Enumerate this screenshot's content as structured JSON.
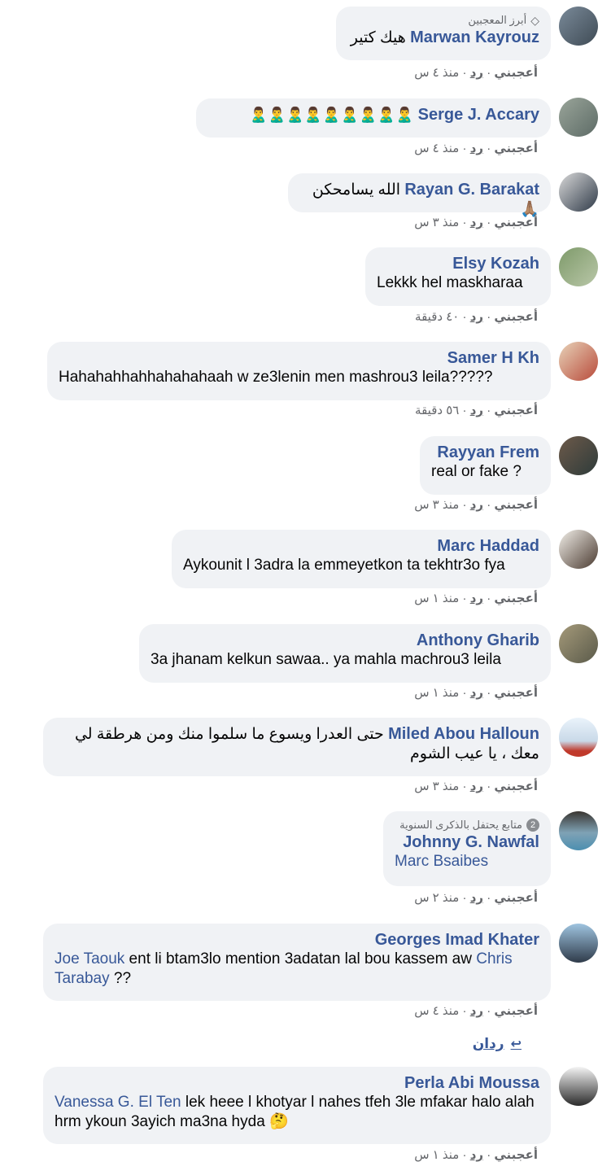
{
  "common": {
    "like": "أعجبني",
    "reply": "رد",
    "dot": "·"
  },
  "comments": [
    {
      "badge": "أبرز المعجبين",
      "name": "Marwan Kayrouz",
      "text": "هيك كتير",
      "time": "منذ ٤ س"
    },
    {
      "name": "Serge J. Accary",
      "text": "🙎‍♂️🙎‍♂️🙎‍♂️🙎‍♂️🙎‍♂️🙎‍♂️🙎‍♂️🙎‍♂️🙎‍♂️",
      "time": "منذ ٤ س"
    },
    {
      "name": "Rayan G. Barakat",
      "text": "الله يسامحكن 🙏🏽",
      "time": "منذ ٣ س"
    },
    {
      "name": "Elsy Kozah",
      "text": "Lekkk hel maskharaa",
      "time": "٤٠ دقيقة"
    },
    {
      "name": "Samer H Kh",
      "text": "Hahahahhahhahahahaah w ze3lenin men mashrou3 leila?????",
      "time": "٥٦ دقيقة"
    },
    {
      "name": "Rayyan Frem",
      "text": "real or fake ?",
      "time": "منذ ٣ س"
    },
    {
      "name": "Marc Haddad",
      "text": "Aykounit l 3adra la emmeyetkon ta tekhtr3o fya",
      "time": "منذ ١ س"
    },
    {
      "name": "Anthony Gharib",
      "text": "3a jhanam kelkun sawaa.. ya mahla machrou3 leila",
      "time": "منذ ١ س"
    },
    {
      "name": "Miled Abou Halloun",
      "text": "حتى العدرا ويسوع ما سلموا منك ومن هرطقة لي معك ، يا عيب الشوم",
      "time": "منذ ٣ س"
    },
    {
      "badge": "متابع يحتفل بالذكرى السنوية",
      "name": "Johnny G. Nawfal",
      "mention": "Marc Bsaibes",
      "time": "منذ ٢ س"
    },
    {
      "name": "Georges Imad Khater",
      "mention1": "Joe Taouk",
      "text1": " ent li btam3lo mention 3adatan lal bou kassem aw ",
      "mention2": "Chris Tarabay",
      "text2": " ??",
      "time": "منذ ٤ س"
    },
    {
      "name": "Perla Abi Moussa",
      "mention": "Vanessa G. El Ten",
      "text": " lek heee l khotyar l nahes tfeh 3le mfakar halo alah hrm ykoun 3ayich ma3na hyda 🤔",
      "time": "منذ ١ س"
    }
  ],
  "replies_link": "ردان",
  "colors": {
    "link": "#385898",
    "bubble": "#f0f2f5",
    "meta": "#65676b"
  }
}
